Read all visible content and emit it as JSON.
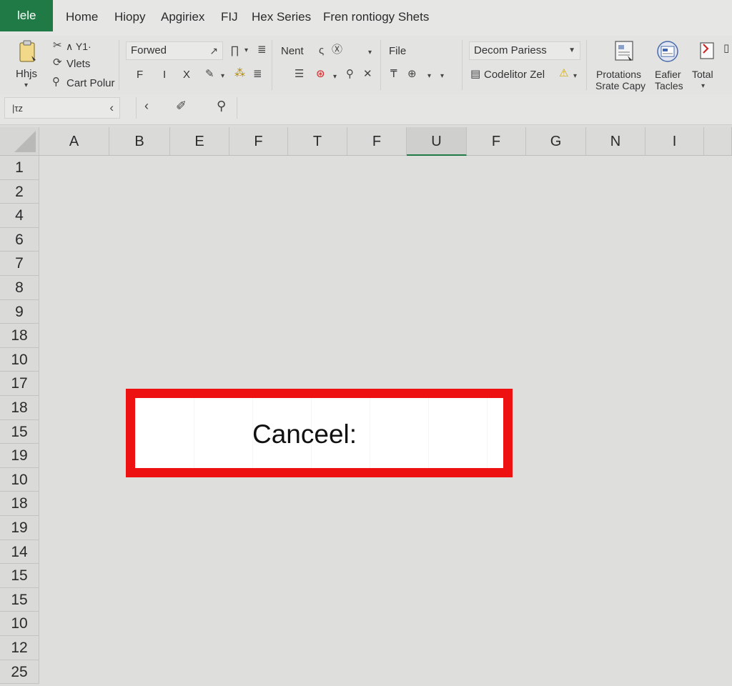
{
  "menubar": {
    "file_tab": "lele",
    "items": [
      "Home",
      "Hiopy",
      "Apgiriex",
      "FIJ",
      "Hex Series",
      "Fren rontiogy Shets"
    ]
  },
  "ribbon": {
    "clipboard": {
      "paste_label": "Hhjs",
      "item1": "∧ Y1·",
      "item2": "Vlets",
      "item3": "Cart Polur"
    },
    "font": {
      "font_name": "Forwed",
      "bold": "F",
      "italic": "I",
      "strike": "X"
    },
    "align": {
      "label": "Nent"
    },
    "number": {
      "label": "File"
    },
    "styles": {
      "dropdown": "Decom Pariess",
      "cond": "Codelitor Zel"
    },
    "right_buttons": [
      {
        "line1": "Protations",
        "line2": "Srate Capy"
      },
      {
        "line1": "Eafier",
        "line2": "Tacles"
      },
      {
        "line1": "Total",
        "line2": ""
      }
    ]
  },
  "formula_bar": {
    "name_box": "|τz"
  },
  "grid": {
    "columns": [
      "A",
      "B",
      "E",
      "F",
      "T",
      "F",
      "U",
      "F",
      "G",
      "N",
      "I",
      ""
    ],
    "selected_column_index": 6,
    "rows": [
      "1",
      "2",
      "4",
      "6",
      "7",
      "8",
      "9",
      "18",
      "10",
      "17",
      "18",
      "15",
      "19",
      "10",
      "18",
      "19",
      "14",
      "15",
      "15",
      "10",
      "12",
      "25"
    ]
  },
  "highlight": {
    "text": "Canceel:",
    "border_color": "#ee1111"
  },
  "colors": {
    "accent": "#1f7a45"
  }
}
